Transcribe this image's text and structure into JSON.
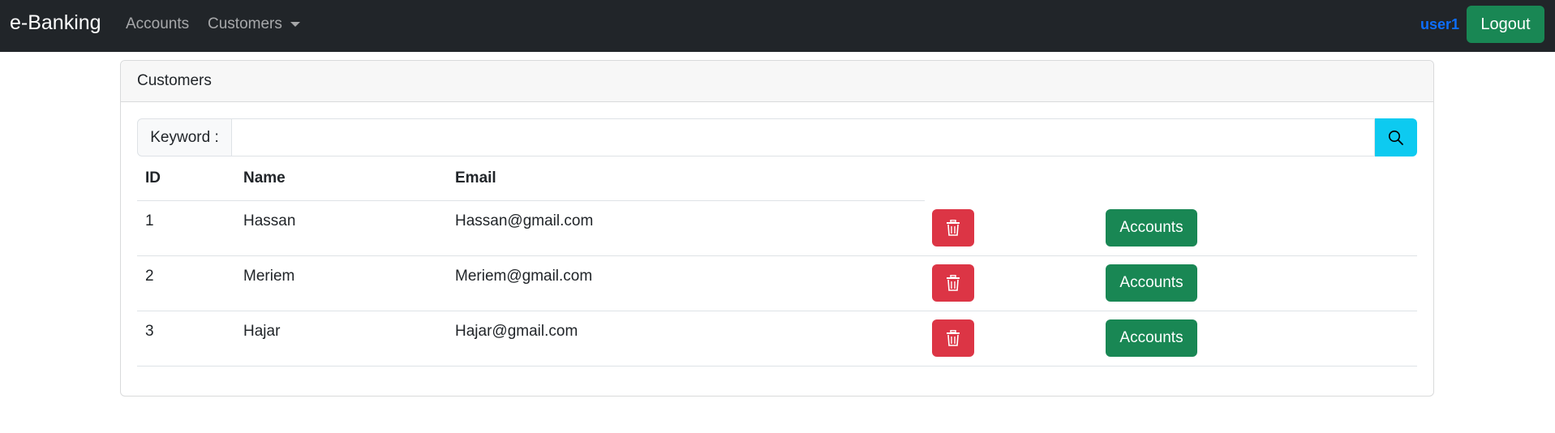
{
  "navbar": {
    "brand": "e-Banking",
    "links": [
      {
        "label": "Accounts"
      },
      {
        "label": "Customers",
        "icon": "caret-down-icon"
      }
    ],
    "user": "user1",
    "logout_label": "Logout"
  },
  "card": {
    "title": "Customers",
    "search": {
      "label": "Keyword :",
      "value": "",
      "placeholder": "",
      "button_icon": "search-icon"
    },
    "table": {
      "headers": [
        "ID",
        "Name",
        "Email"
      ],
      "rows": [
        {
          "id": "1",
          "name": "Hassan",
          "email": "Hassan@gmail.com"
        },
        {
          "id": "2",
          "name": "Meriem",
          "email": "Meriem@gmail.com"
        },
        {
          "id": "3",
          "name": "Hajar",
          "email": "Hajar@gmail.com"
        }
      ],
      "delete_icon": "trash-icon",
      "accounts_label": "Accounts"
    }
  },
  "colors": {
    "navbar_bg": "#212529",
    "success": "#198754",
    "danger": "#dc3545",
    "info": "#0dcaf0",
    "user_link": "#0d6efd"
  }
}
